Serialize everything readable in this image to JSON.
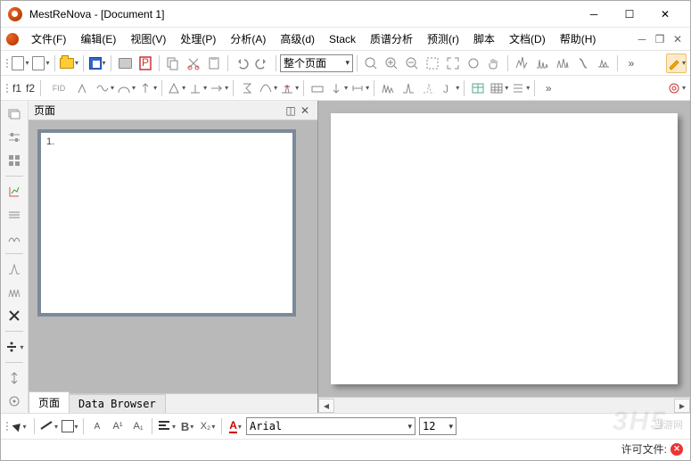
{
  "window": {
    "app": "MestReNova",
    "doc": "[Document 1]",
    "title_sep": " - "
  },
  "menu": {
    "file": "文件(F)",
    "edit": "编辑(E)",
    "view": "视图(V)",
    "process": "处理(P)",
    "analyze": "分析(A)",
    "advanced": "高级(d)",
    "stack": "Stack",
    "mass": "质谱分析",
    "predict": "预测(r)",
    "script": "脚本",
    "docmenu": "文档(D)",
    "help": "帮助(H)"
  },
  "toolbar1": {
    "zoom_combo": "整个页面"
  },
  "toolbar2": {
    "f1": "f1",
    "f2": "f2",
    "fid": "FID"
  },
  "pages_panel": {
    "title": "页面",
    "page_number": "1."
  },
  "tabs": {
    "pages": "页面",
    "data_browser": "Data Browser"
  },
  "font_bar": {
    "font_name": "Arial",
    "font_size": "12",
    "small_a": "A",
    "sup": "A¹",
    "sub": "A₁",
    "bold": "B",
    "x2": "X₂",
    "a_color": "A"
  },
  "status": {
    "license_label": "许可文件:"
  },
  "watermark": {
    "big": "3H5",
    "small": "当游网"
  }
}
